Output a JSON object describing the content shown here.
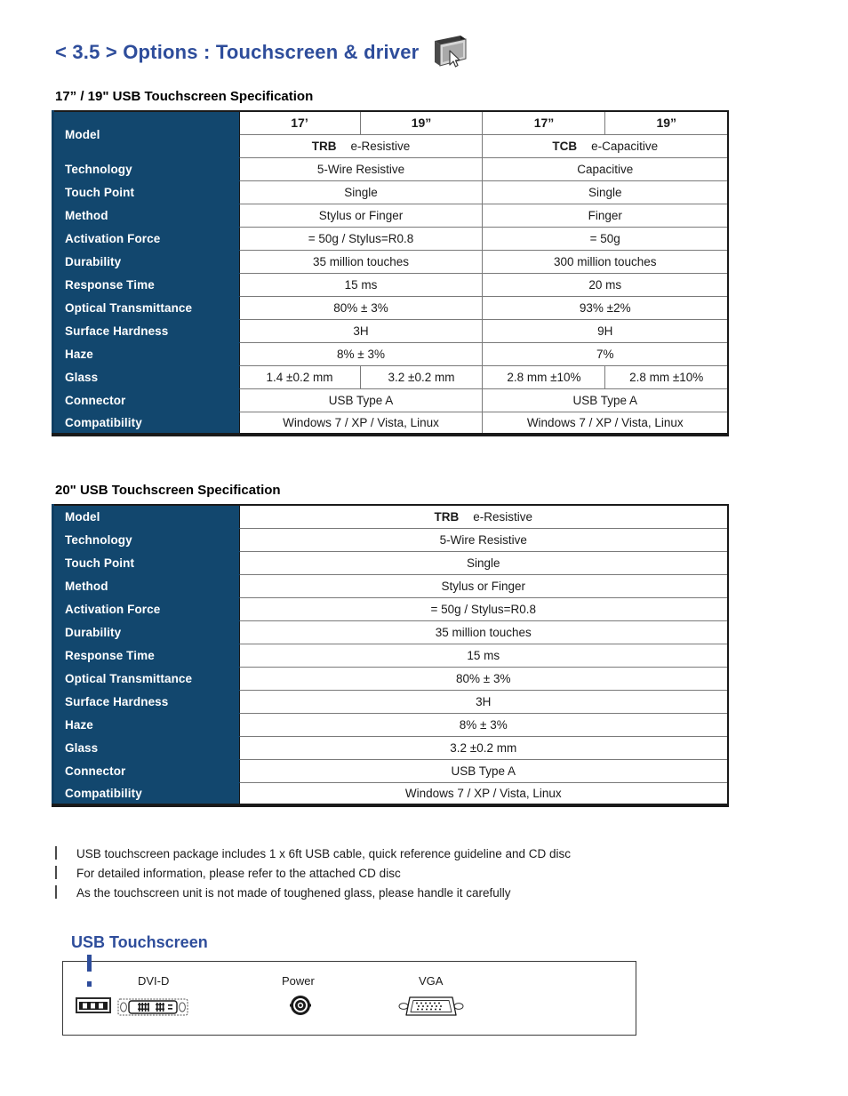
{
  "header": {
    "title": "< 3.5 > Options : Touchscreen & driver",
    "icon": "touchscreen-monitor-cursor-icon",
    "title_color": "#2E4D9B"
  },
  "colors": {
    "accent_blue": "#2E4D9B",
    "table_header_navy": "#12476E",
    "border_dark": "#1a1a1a",
    "grid_gray": "#7a7a7a"
  },
  "section1": {
    "title": "17” / 19\" USB Touchscreen Specification",
    "table": {
      "type": "table",
      "size_headers": [
        "17’",
        "19”",
        "17”",
        "19”"
      ],
      "model_left_brand": "TRB",
      "model_left_kind": "e-Resistive",
      "model_right_brand": "TCB",
      "model_right_kind": "e-Capacitive",
      "model_row_label": "Model",
      "rows": [
        {
          "label": "Technology",
          "left": "5-Wire Resistive",
          "right": "Capacitive"
        },
        {
          "label": "Touch Point",
          "left": "Single",
          "right": "Single"
        },
        {
          "label": "Method",
          "left": "Stylus or Finger",
          "right": "Finger"
        },
        {
          "label": "Activation Force",
          "left": "= 50g / Stylus=R0.8",
          "right": "= 50g"
        },
        {
          "label": "Durability",
          "left": "35 million touches",
          "right": "300 million touches"
        },
        {
          "label": "Response Time",
          "left": "15 ms",
          "right": "20 ms"
        },
        {
          "label": "Optical Transmittance",
          "left": "80% ± 3%",
          "right": "93% ±2%"
        },
        {
          "label": "Surface Hardness",
          "left": "3H",
          "right": "9H"
        },
        {
          "label": "Haze",
          "left": "8% ± 3%",
          "right": "7%"
        }
      ],
      "glass": {
        "label": "Glass",
        "values": [
          "1.4 ±0.2 mm",
          "3.2 ±0.2 mm",
          "2.8 mm ±10%",
          "2.8 mm ±10%"
        ]
      },
      "tail_rows": [
        {
          "label": "Connector",
          "left": "USB Type A",
          "right": "USB Type A"
        },
        {
          "label": "Compatibility",
          "left": "Windows 7 / XP / Vista, Linux",
          "right": "Windows 7 / XP / Vista, Linux"
        }
      ]
    }
  },
  "section2": {
    "title": "20\" USB Touchscreen Specification",
    "table": {
      "type": "table",
      "model_row_label": "Model",
      "model_brand": "TRB",
      "model_kind": "e-Resistive",
      "rows": [
        {
          "label": "Technology",
          "value": "5-Wire Resistive"
        },
        {
          "label": "Touch Point",
          "value": "Single"
        },
        {
          "label": "Method",
          "value": "Stylus or Finger"
        },
        {
          "label": "Activation Force",
          "value": "= 50g / Stylus=R0.8"
        },
        {
          "label": "Durability",
          "value": "35 million touches"
        },
        {
          "label": "Response Time",
          "value": "15 ms"
        },
        {
          "label": "Optical Transmittance",
          "value": "80% ± 3%"
        },
        {
          "label": "Surface Hardness",
          "value": "3H"
        },
        {
          "label": "Haze",
          "value": "8% ± 3%"
        },
        {
          "label": "Glass",
          "value": "3.2 ±0.2 mm"
        },
        {
          "label": "Connector",
          "value": "USB Type A"
        },
        {
          "label": "Compatibility",
          "value": "Windows 7 / XP / Vista, Linux"
        }
      ]
    }
  },
  "notes": [
    "USB touchscreen package includes 1 x 6ft USB cable, quick reference guideline and CD disc",
    "For detailed information, please refer to the attached CD disc",
    "As the touchscreen unit is not made of toughened glass, please handle it carefully"
  ],
  "usb_panel": {
    "heading": "USB Touchscreen",
    "ports": [
      {
        "label": "",
        "icon": "usb-port-icon"
      },
      {
        "label": "DVI-D",
        "icon": "dvi-d-connector-icon"
      },
      {
        "label": "Power",
        "icon": "dc-power-jack-icon"
      },
      {
        "label": "VGA",
        "icon": "vga-db15-connector-icon"
      }
    ],
    "marker_color": "#2E4D9B"
  }
}
